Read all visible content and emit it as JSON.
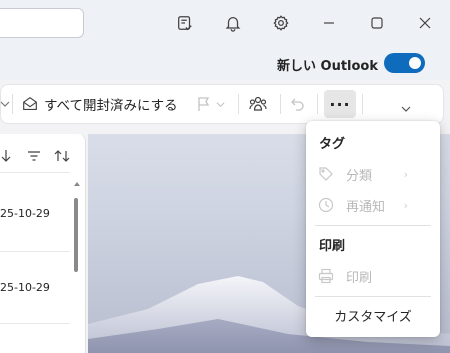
{
  "titlebar": {
    "icons": [
      "note-check-icon",
      "bell-icon",
      "gear-icon"
    ],
    "window": [
      "minimize-icon",
      "maximize-icon",
      "close-icon"
    ]
  },
  "new_outlook": {
    "label": "新しい Outlook",
    "toggle_on": true,
    "accent": "#0f6cbd"
  },
  "ribbon": {
    "mark_all_read": "すべて開封済みにする",
    "more_label": "···"
  },
  "message_list": {
    "dates": [
      "25-10-29",
      "25-10-29"
    ]
  },
  "menu": {
    "sections": [
      {
        "header": "タグ",
        "items": [
          {
            "label": "分類",
            "icon": "tag-icon",
            "disabled": true,
            "submenu": true
          },
          {
            "label": "再通知",
            "icon": "clock-icon",
            "disabled": true,
            "submenu": true
          }
        ]
      },
      {
        "header": "印刷",
        "items": [
          {
            "label": "印刷",
            "icon": "printer-icon",
            "disabled": true,
            "submenu": false
          }
        ]
      }
    ],
    "customize": "カスタマイズ"
  }
}
